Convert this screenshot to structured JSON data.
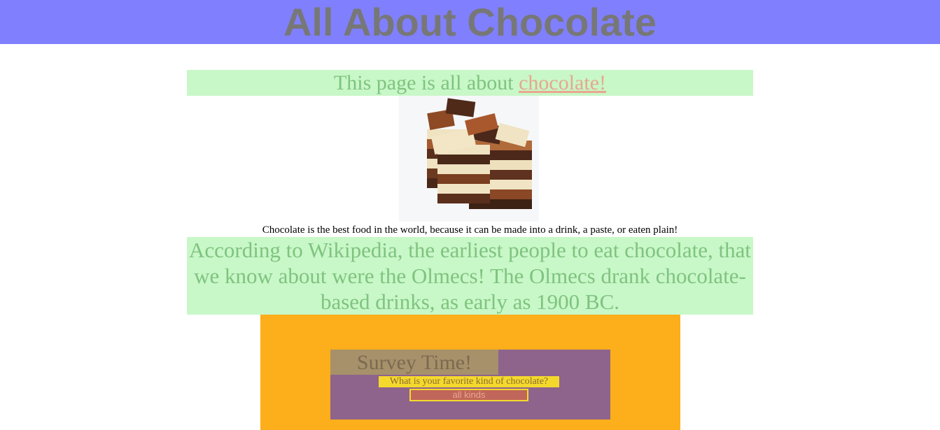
{
  "header": {
    "title": "All About Chocolate"
  },
  "intro": {
    "text": "This page is all about ",
    "link_text": "chocolate!"
  },
  "photo": {
    "alt": "Stack of chocolate bars"
  },
  "caption": "Chocolate is the best food in the world, because it can be made into a drink, a paste, or eaten plain!",
  "wiki": {
    "text": "According to Wikipedia, the earliest people to eat chocolate, that we know about were the Olmecs! The Olmecs drank chocolate-based drinks, as early as 1900 BC."
  },
  "survey": {
    "title": "Survey Time!",
    "question": "What is your favorite kind of chocolate?",
    "answer_value": "all kinds"
  },
  "colors": {
    "header_bg": "#8080ff",
    "highlight_green": "#c8f7c8",
    "text_green": "#7fc37f",
    "link_salmon": "#e8a78e",
    "survey_orange": "#fdae1b",
    "survey_purple": "#8e648c",
    "question_yellow": "#f4d92c",
    "answer_red": "#c1665a"
  }
}
